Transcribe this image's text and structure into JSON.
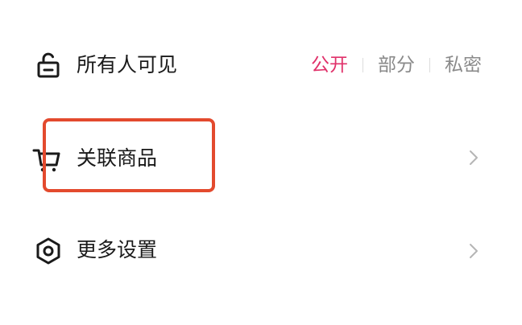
{
  "visibility": {
    "label": "所有人可见",
    "icon": "unlock-icon",
    "options": [
      {
        "label": "公开",
        "selected": true
      },
      {
        "label": "部分",
        "selected": false
      },
      {
        "label": "私密",
        "selected": false
      }
    ],
    "active_color": "#e0316a"
  },
  "products": {
    "label": "关联商品",
    "icon": "shopping-cart-icon"
  },
  "more_settings": {
    "label": "更多设置",
    "icon": "hexagon-settings-icon"
  },
  "highlight_color": "#e34a2e"
}
